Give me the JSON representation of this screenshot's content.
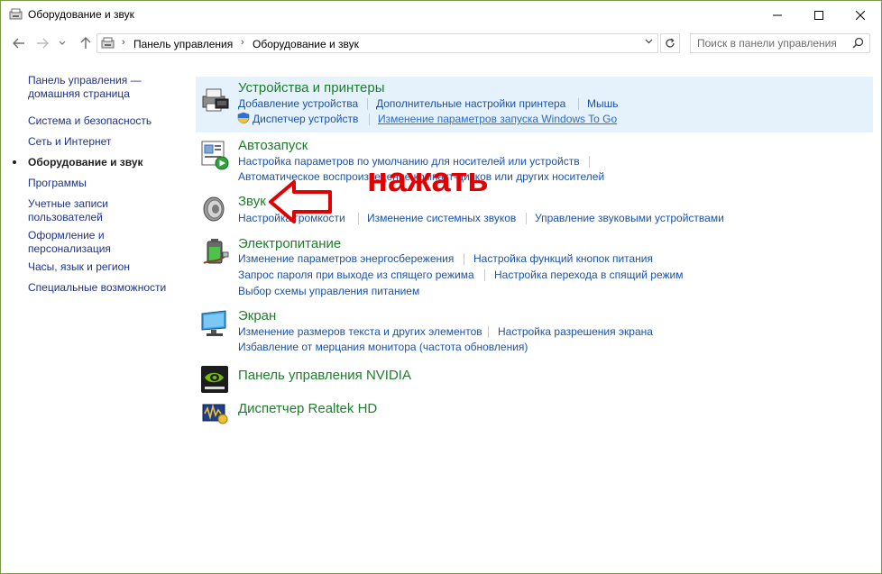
{
  "window": {
    "title": "Оборудование и звук"
  },
  "address": {
    "crumbs": [
      "Панель управления",
      "Оборудование и звук"
    ]
  },
  "search": {
    "placeholder": "Поиск в панели управления"
  },
  "sidebar": {
    "items": [
      {
        "label": "Панель управления — домашняя страница"
      },
      {
        "label": "Система и безопасность"
      },
      {
        "label": "Сеть и Интернет"
      },
      {
        "label": "Оборудование и звук",
        "current": true
      },
      {
        "label": "Программы"
      },
      {
        "label": "Учетные записи пользователей"
      },
      {
        "label": "Оформление и персонализация"
      },
      {
        "label": "Часы, язык и регион"
      },
      {
        "label": "Специальные возможности"
      }
    ]
  },
  "categories": {
    "devices": {
      "title": "Устройства и принтеры",
      "links": [
        "Добавление устройства",
        "Дополнительные настройки принтера",
        "Мышь",
        "Диспетчер устройств",
        "Изменение параметров запуска Windows To Go"
      ]
    },
    "autoplay": {
      "title": "Автозапуск",
      "links": [
        "Настройка параметров по умолчанию для носителей или устройств",
        "Автоматическое воспроизведение компакт-дисков или других носителей"
      ]
    },
    "sound": {
      "title": "Звук",
      "links": [
        "Настройка громкости",
        "Изменение системных звуков",
        "Управление звуковыми устройствами"
      ]
    },
    "power": {
      "title": "Электропитание",
      "links": [
        "Изменение параметров энергосбережения",
        "Настройка функций кнопок питания",
        "Запрос пароля при выходе из спящего режима",
        "Настройка перехода в спящий режим",
        "Выбор схемы управления питанием"
      ]
    },
    "display": {
      "title": "Экран",
      "links": [
        "Изменение размеров текста и других элементов",
        "Настройка разрешения экрана",
        "Избавление от мерцания монитора (частота обновления)"
      ]
    },
    "nvidia": {
      "title": "Панель управления NVIDIA"
    },
    "realtek": {
      "title": "Диспетчер Realtek HD"
    }
  },
  "annotation": {
    "text": "нажать"
  },
  "colors": {
    "accent_green": "#1e7d2b",
    "link_blue": "#1a52a8",
    "highlight": "#e5f1fb",
    "annotation_red": "#e00000"
  }
}
